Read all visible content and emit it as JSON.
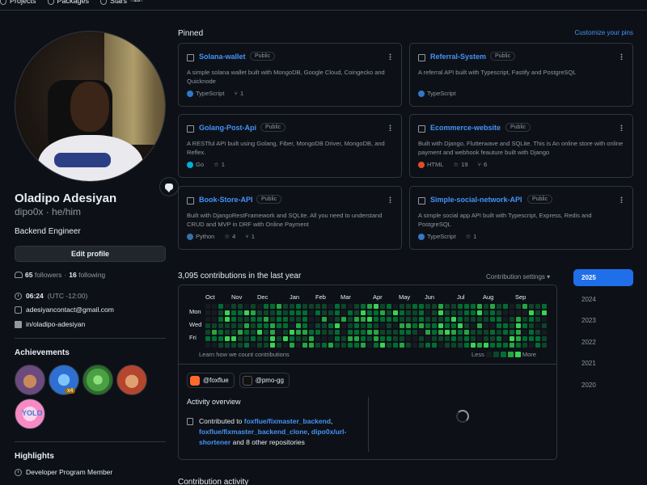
{
  "topnav": {
    "tabs": [
      {
        "label": "Projects"
      },
      {
        "label": "Packages"
      },
      {
        "label": "Stars",
        "count": "13"
      }
    ]
  },
  "profile": {
    "name": "Oladipo Adesiyan",
    "login": "dipo0x · he/him",
    "bio": "Backend Engineer",
    "edit_label": "Edit profile",
    "followers": "65",
    "followers_label": "followers",
    "following": "16",
    "following_label": "following",
    "time": "06:24",
    "timezone": "(UTC -12:00)",
    "email": "adesiyancontact@gmail.com",
    "linkedin": "in/oladipo-adesiyan"
  },
  "achievements": {
    "title": "Achievements",
    "multiplier": "x4",
    "yolo": "YOLO"
  },
  "highlights": {
    "title": "Highlights",
    "item": "Developer Program Member"
  },
  "pinned": {
    "title": "Pinned",
    "customize": "Customize your pins",
    "cards": [
      {
        "name": "Solana-wallet",
        "visibility": "Public",
        "desc": "A simple solana wallet built with MongoDB, Google Cloud, Coingecko and Quicknode",
        "lang": "TypeScript",
        "lang_color": "#3178c6",
        "stars": "",
        "forks": "1"
      },
      {
        "name": "Referral-System",
        "visibility": "Public",
        "desc": "A referral API built with Typescript, Fastify and PostgreSQL",
        "lang": "TypeScript",
        "lang_color": "#3178c6",
        "stars": "",
        "forks": ""
      },
      {
        "name": "Golang-Post-Api",
        "visibility": "Public",
        "desc": "A RESTful API built using Golang, Fiber, MongoDB Driver, MongoDB, and Reflex.",
        "lang": "Go",
        "lang_color": "#00add8",
        "stars": "1",
        "forks": ""
      },
      {
        "name": "Ecommerce-website",
        "visibility": "Public",
        "desc": "Built with Django, Flutterwave and SQLite. This is An online store with online payment and webhook feauture built with Django",
        "lang": "HTML",
        "lang_color": "#e34c26",
        "stars": "19",
        "forks": "6"
      },
      {
        "name": "Book-Store-API",
        "visibility": "Public",
        "desc": "Built with DjangoRestFramework and SQLite. All you need to understand CRUD and MVP in DRF with Online Payment",
        "lang": "Python",
        "lang_color": "#3572a5",
        "stars": "4",
        "forks": "1"
      },
      {
        "name": "Simple-social-network-API",
        "visibility": "Public",
        "desc": "A simple social app API built with Typescript, Express, Redis and PostgreSQL",
        "lang": "TypeScript",
        "lang_color": "#3178c6",
        "stars": "1",
        "forks": ""
      }
    ]
  },
  "contributions": {
    "title": "3,095 contributions in the last year",
    "settings": "Contribution settings",
    "months": [
      "Oct",
      "Nov",
      "Dec",
      "Jan",
      "Feb",
      "Mar",
      "Apr",
      "May",
      "Jun",
      "Jul",
      "Aug",
      "Sep"
    ],
    "days": [
      "Mon",
      "Wed",
      "Fri"
    ],
    "learn": "Learn how we count contributions",
    "less": "Less",
    "more": "More",
    "colors": [
      "#161b22",
      "#0e4429",
      "#006d32",
      "#26a641",
      "#39d353"
    ]
  },
  "activity": {
    "orgs": [
      "@foxflue",
      "@pmo-gg"
    ],
    "overview_title": "Activity overview",
    "contributed_prefix": "Contributed to",
    "repo1": "foxflue/fixmaster_backend",
    "repo2": "foxflue/fixmaster_backend_clone",
    "repo3": "dipo0x/url-shortener",
    "suffix": "and 8 other repositories"
  },
  "years": [
    "2025",
    "2024",
    "2023",
    "2022",
    "2021",
    "2020"
  ],
  "contribution_activity_title": "Contribution activity"
}
